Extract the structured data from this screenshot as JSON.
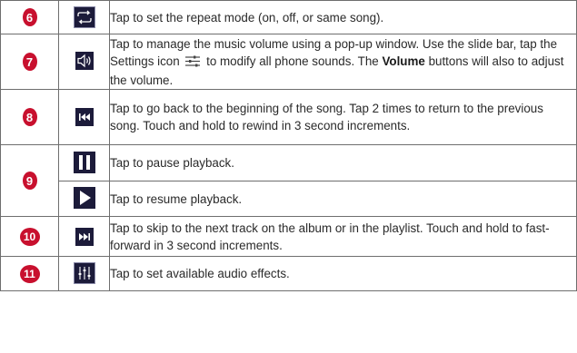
{
  "colors": {
    "badge": "#c8102e",
    "icon_bg": "#1c1b3a",
    "icon_fg": "#ffffff",
    "border": "#6e6e6e",
    "text": "#2a2a2a"
  },
  "rows": [
    {
      "num": "6",
      "icon": "repeat-icon",
      "text": "Tap to set the repeat mode (on, off, or same song)."
    },
    {
      "num": "7",
      "icon": "volume-icon",
      "text_a": "Tap to manage the music volume using a pop-up window. Use the slide bar, tap the Settings icon",
      "settings_icon": "settings-sliders-icon",
      "text_b": "to modify all phone sounds. The",
      "text_bold": "Volume",
      "text_c": "buttons will also to adjust the volume."
    },
    {
      "num": "8",
      "icon": "rewind-icon",
      "text": "Tap to go back to the beginning of the song. Tap 2 times to return to the previous song. Touch and hold to rewind in 3 second increments."
    },
    {
      "num": "9",
      "icon": "pause-icon",
      "text": "Tap to pause playback."
    },
    {
      "icon": "play-icon",
      "text": "Tap to resume playback."
    },
    {
      "num": "10",
      "icon": "fast-forward-icon",
      "text": "Tap to skip to the next track on the album or in the playlist. Touch and hold to fast-forward in 3 second increments."
    },
    {
      "num": "11",
      "icon": "equalizer-icon",
      "text": "Tap to set available audio effects."
    }
  ]
}
